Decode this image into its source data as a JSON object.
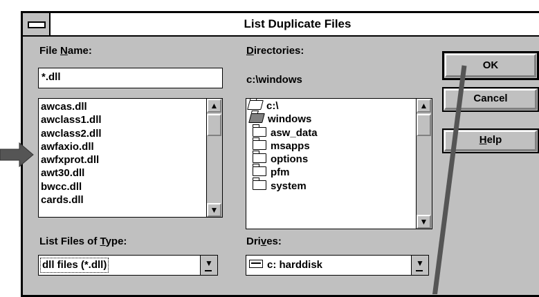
{
  "dialog": {
    "title": "List Duplicate Files"
  },
  "file_name": {
    "label": "File Name:",
    "label_pre": "File ",
    "label_accel": "N",
    "label_post": "ame:",
    "value": "*.dll",
    "files": [
      "awcas.dll",
      "awclass1.dll",
      "awclass2.dll",
      "awfaxio.dll",
      "awfxprot.dll",
      "awt30.dll",
      "bwcc.dll",
      "cards.dll"
    ]
  },
  "directories": {
    "label_accel": "D",
    "label_post": "irectories:",
    "current_path": "c:\\windows",
    "items": [
      "c:\\",
      "windows",
      "asw_data",
      "msapps",
      "options",
      "pfm",
      "system"
    ]
  },
  "file_type": {
    "label_pre": "List Files of ",
    "label_accel": "T",
    "label_post": "ype:",
    "value": "dll files (*.dll)"
  },
  "drives": {
    "label_pre": "Dri",
    "label_accel": "v",
    "label_post": "es:",
    "value": "c: harddisk"
  },
  "buttons": {
    "ok": "OK",
    "cancel": "Cancel",
    "help_accel": "H",
    "help_post": "elp"
  },
  "colors": {
    "dialog_bg": "#c0c0c0",
    "annotation_arrow": "#555555"
  }
}
